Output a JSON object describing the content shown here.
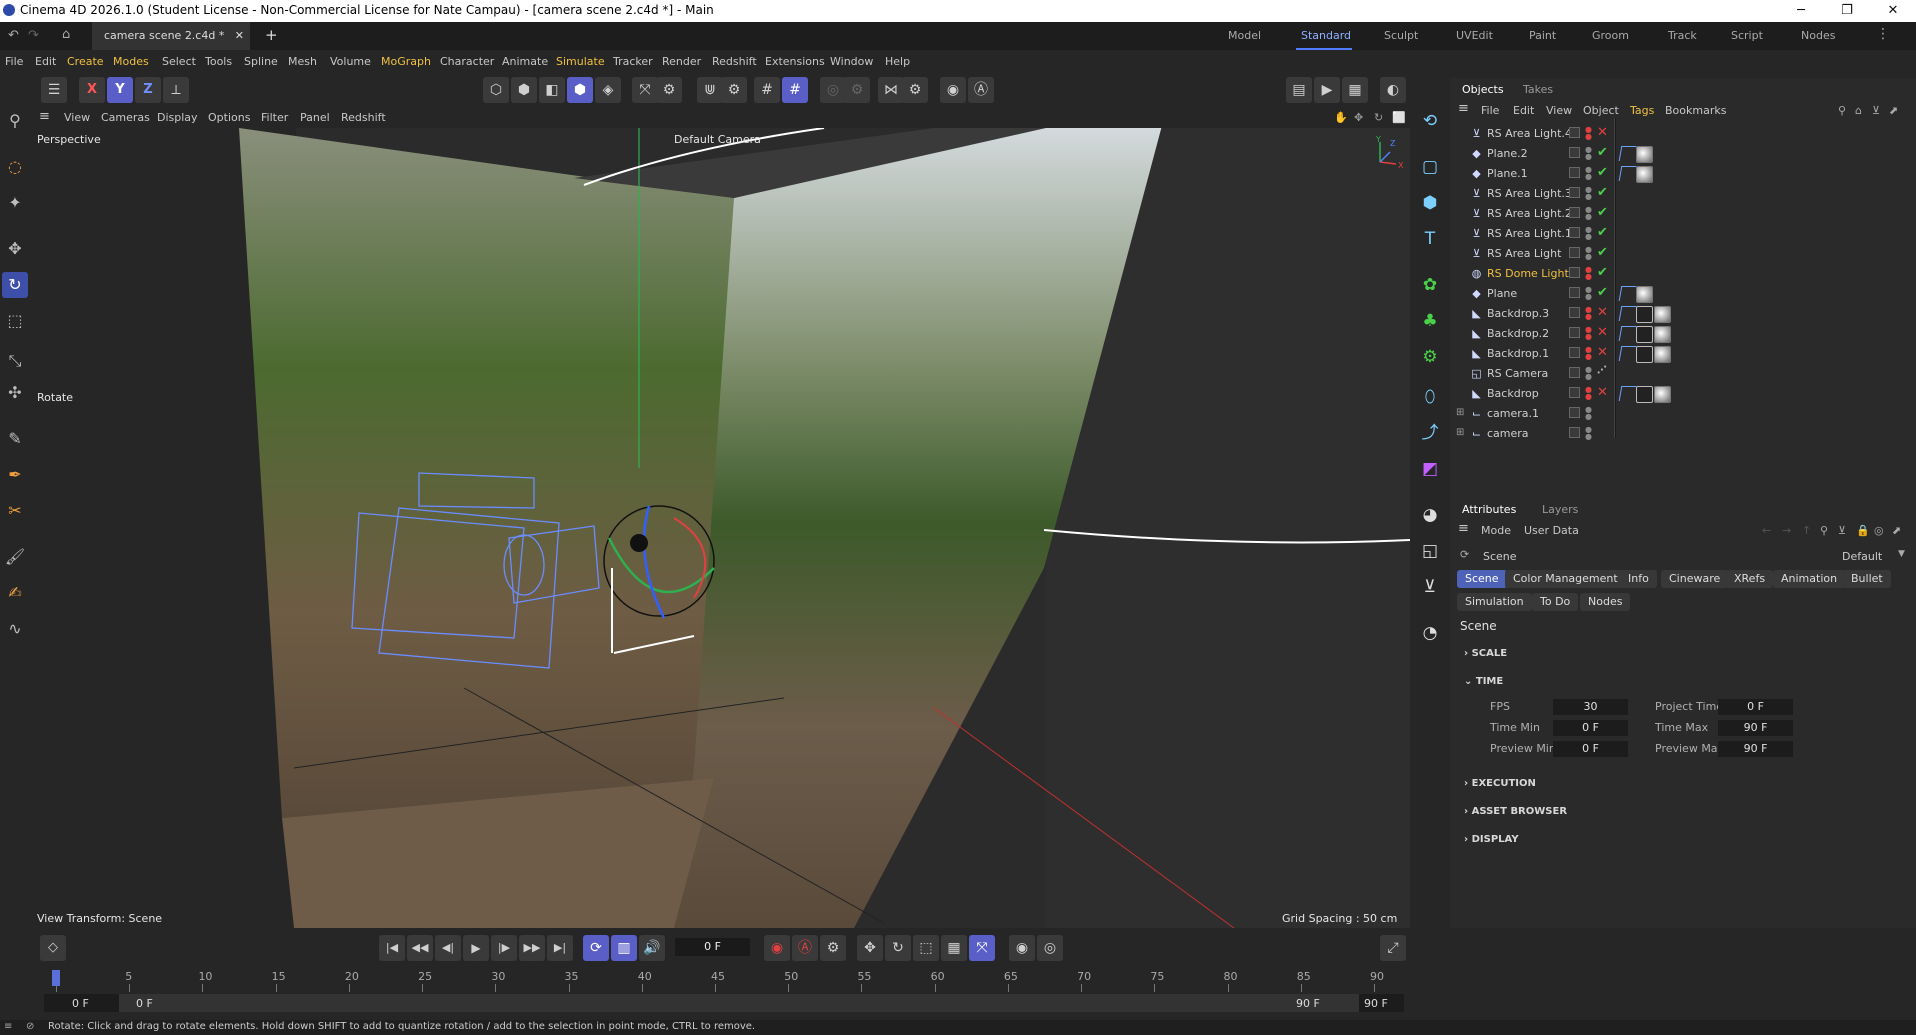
{
  "window": {
    "title": "Cinema 4D 2026.1.0 (Student License - Non-Commercial License for Nate Campau) - [camera scene 2.c4d *] - Main",
    "minimize": "─",
    "maximize": "❐",
    "close": "✕"
  },
  "document_tab": {
    "label": "camera scene 2.c4d *",
    "close": "✕",
    "add": "+"
  },
  "layouts": {
    "items": [
      "Model",
      "Standard",
      "Sculpt",
      "UVEdit",
      "Paint",
      "Groom",
      "Track",
      "Script",
      "Nodes"
    ],
    "active": "Standard",
    "more": "⋮"
  },
  "menu": [
    "File",
    "Edit",
    "Create",
    "Modes",
    "Select",
    "Tools",
    "Spline",
    "Mesh",
    "Volume",
    "MoGraph",
    "Character",
    "Animate",
    "Simulate",
    "Tracker",
    "Render",
    "Redshift",
    "Extensions",
    "Window",
    "Help"
  ],
  "axis_buttons": {
    "x": "X",
    "y": "Y",
    "z": "Z"
  },
  "viewport_menu": [
    "View",
    "Cameras",
    "Display",
    "Options",
    "Filter",
    "Panel",
    "Redshift"
  ],
  "viewport": {
    "projection": "Perspective",
    "camera": "Default Camera",
    "tool": "Rotate",
    "view_transform": "View Transform: Scene",
    "grid_spacing": "Grid Spacing : 50 cm",
    "axes": {
      "x": "X",
      "y": "Y",
      "z": "Z"
    }
  },
  "objects_panel": {
    "tabs": [
      "Objects",
      "Takes"
    ],
    "menu": [
      "File",
      "Edit",
      "View",
      "Object",
      "Tags",
      "Bookmarks"
    ],
    "active_menu": "Tags",
    "rows": [
      {
        "name": "RS Area Light.4",
        "icon": "light",
        "status": "no"
      },
      {
        "name": "Plane.2",
        "icon": "plane",
        "status": "ok"
      },
      {
        "name": "Plane.1",
        "icon": "plane",
        "status": "ok"
      },
      {
        "name": "RS Area Light.3",
        "icon": "light",
        "status": "ok"
      },
      {
        "name": "RS Area Light.2",
        "icon": "light",
        "status": "ok"
      },
      {
        "name": "RS Area Light.1",
        "icon": "light",
        "status": "ok"
      },
      {
        "name": "RS Area Light",
        "icon": "light",
        "status": "ok"
      },
      {
        "name": "RS Dome Light",
        "icon": "dome",
        "status": "ok",
        "selected": true
      },
      {
        "name": "Plane",
        "icon": "plane",
        "status": "ok"
      },
      {
        "name": "Backdrop.3",
        "icon": "backdrop",
        "status": "no"
      },
      {
        "name": "Backdrop.2",
        "icon": "backdrop",
        "status": "no"
      },
      {
        "name": "Backdrop.1",
        "icon": "backdrop",
        "status": "no"
      },
      {
        "name": "RS Camera",
        "icon": "camera",
        "status": ""
      },
      {
        "name": "Backdrop",
        "icon": "backdrop",
        "status": "no"
      },
      {
        "name": "camera.1",
        "icon": "null",
        "status": ""
      },
      {
        "name": "camera",
        "icon": "null",
        "status": ""
      }
    ]
  },
  "attributes_panel": {
    "tabs": [
      "Attributes",
      "Layers"
    ],
    "menu": [
      "Mode",
      "User Data"
    ],
    "object_label": "Scene",
    "preset": "Default",
    "pills_row1": [
      "Scene",
      "Color Management",
      "Info",
      "Cineware",
      "XRefs",
      "Animation",
      "Bullet"
    ],
    "pills_row2": [
      "Simulation",
      "To Do",
      "Nodes"
    ],
    "active_pill": "Scene",
    "heading": "Scene",
    "sections": {
      "scale": "SCALE",
      "time": "TIME",
      "execution": "EXECUTION",
      "asset_browser": "ASSET BROWSER",
      "display": "DISPLAY"
    },
    "time": {
      "fps_label": "FPS",
      "fps": "30",
      "project_time_label": "Project Time",
      "project_time": "0 F",
      "time_min_label": "Time Min",
      "time_min": "0 F",
      "time_max_label": "Time Max",
      "time_max": "90 F",
      "preview_min_label": "Preview Min",
      "preview_min": "0 F",
      "preview_max_label": "Preview Max",
      "preview_max": "90 F"
    }
  },
  "timeline": {
    "current_frame": "0 F",
    "ticks": [
      "0",
      "5",
      "10",
      "15",
      "20",
      "25",
      "30",
      "35",
      "40",
      "45",
      "50",
      "55",
      "60",
      "65",
      "70",
      "75",
      "80",
      "85",
      "90"
    ],
    "range_start": "0 F",
    "range_start2": "0 F",
    "range_end": "90 F",
    "range_end2": "90 F"
  },
  "status_bar": {
    "text": "Rotate: Click and drag to rotate elements. Hold down SHIFT to add to quantize rotation / add to the selection in point mode, CTRL to remove."
  },
  "colors": {
    "accent": "#4e63b8",
    "highlight_text": "#f0c040",
    "ok": "#4ad04a",
    "error": "#e04040"
  }
}
